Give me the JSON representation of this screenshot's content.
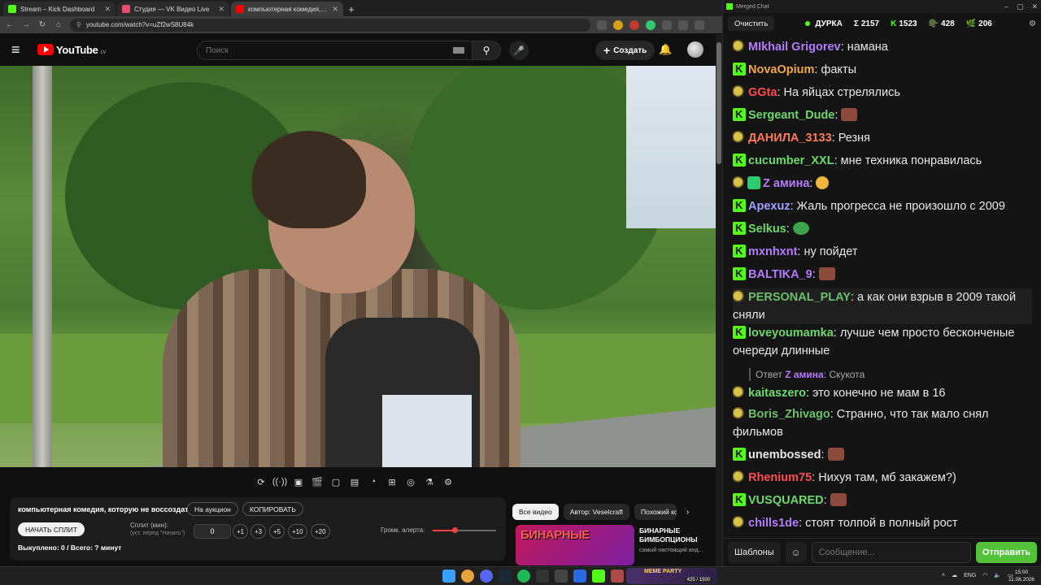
{
  "browser": {
    "tabs": [
      {
        "label": "Stream – Kick Dashboard",
        "icon_color": "#53fc18",
        "active": false
      },
      {
        "label": "Студия — VK Видео Live",
        "icon_color": "#e74c6c",
        "active": false
      },
      {
        "label": "компьютерная комедия, которую",
        "icon_color": "#ff0000",
        "active": true
      }
    ],
    "url": "youtube.com/watch?v=uZf2wS8U84k"
  },
  "youtube": {
    "logo_text": "YouTube",
    "country_code": "LV",
    "search_placeholder": "Поиск",
    "create_label": "Создать"
  },
  "panel": {
    "title": "компьютерная комедия, которую не воссоздать",
    "auction_btn": "На аукцион",
    "copy_btn": "КОПИРОВАТЬ",
    "start_split_btn": "НАЧАТЬ СПЛИТ",
    "split_label": "Сплит (мин):",
    "split_hint": "(уст. перед \"Начать\")",
    "minutes_value": "0",
    "increments": [
      "+1",
      "+3",
      "+5",
      "+10",
      "+20"
    ],
    "volume_label": "Громк. алерта:",
    "volume_level": 0.35,
    "stats": "Выкуплено: 0 / Всего: ? минут"
  },
  "recommendations": {
    "chips": [
      "Все видео",
      "Автор: Veselcraft",
      "Похожий ко"
    ],
    "thumb_text": "БИНАРНЫЕ",
    "title": "БИНАРНЫЕ БИМБОПЦИОНЫ",
    "subtitle": "самый настоящий анд..."
  },
  "chat": {
    "window_title": "Merged Chat",
    "clear_btn": "Очистить",
    "channel": "ДУРКА",
    "stats": [
      {
        "icon": "Σ",
        "value": "2157"
      },
      {
        "icon": "K",
        "value": "1523"
      },
      {
        "icon": "🪖",
        "value": "428"
      },
      {
        "icon": "🌿",
        "value": "206"
      }
    ],
    "messages": [
      {
        "platform": "tw",
        "user": "MIkhail Grigorev",
        "color": "#b47cff",
        "text": "намана"
      },
      {
        "platform": "kick",
        "user": "NovaOpium",
        "color": "#f0a94a",
        "text": "факты"
      },
      {
        "platform": "tw",
        "user": "GGta",
        "color": "#ff4d4d",
        "text": "На яйцах стрелялись"
      },
      {
        "platform": "kick",
        "user": "Sergeant_Dude",
        "color": "#6cd96c",
        "text": ""
      },
      {
        "platform": "tw",
        "user": "ДАНИЛА_3133",
        "color": "#ff7a5a",
        "text": "Резня"
      },
      {
        "platform": "kick",
        "user": "cucumber_XXL",
        "color": "#6cd96c",
        "text": "мне техника понравилась"
      },
      {
        "platform": "tw",
        "user": "Z амина",
        "color": "#b47cff",
        "text": ""
      },
      {
        "platform": "kick",
        "user": "Apexuz",
        "color": "#a0a0ff",
        "text": "Жаль прогресса не произошло с 2009"
      },
      {
        "platform": "kick",
        "user": "Selkus",
        "color": "#6cd96c",
        "text": ""
      },
      {
        "platform": "kick",
        "user": "mxnhxnt",
        "color": "#b47cff",
        "text": "ну пойдет"
      },
      {
        "platform": "kick",
        "user": "BALTIKA_9",
        "color": "#b47cff",
        "text": ""
      },
      {
        "platform": "tw",
        "user": "PERSONAL_PLAY",
        "color": "#6cbf6c",
        "text": "а как они взрыв в 2009 такой сняли"
      },
      {
        "platform": "kick",
        "user": "loveyoumamka",
        "color": "#6cd96c",
        "text": "лучше чем просто бесконченые очереди длинные"
      },
      {
        "platform": "tw",
        "user": "kaitaszero",
        "color": "#6cd96c",
        "text": "это конечно не мам в 16"
      },
      {
        "platform": "tw",
        "user": "Boris_Zhivago",
        "color": "#6cbf6c",
        "text": "Странно, что так мало снял фильмов"
      },
      {
        "platform": "kick",
        "user": "unembossed",
        "color": "#e8e8e8",
        "text": ""
      },
      {
        "platform": "tw",
        "user": "Rhenium75",
        "color": "#ff4d4d",
        "text": "Нихуя там, мб закажем?)"
      },
      {
        "platform": "kick",
        "user": "VUSQUARED",
        "color": "#6cd96c",
        "text": ""
      },
      {
        "platform": "tw",
        "user": "chills1de",
        "color": "#b47cff",
        "text": "стоят толпой в полный рост"
      }
    ],
    "reply": {
      "prefix": "Ответ",
      "user": "Z амина",
      "text": "Скукота"
    },
    "templates_btn": "Шаблоны",
    "input_placeholder": "Сообщение...",
    "send_btn": "Отправить"
  },
  "taskbar": {
    "widget_text": "MEME PARTY",
    "widget_counter": "425 / 1500",
    "lang": "ENG",
    "time": "15:00",
    "date": "11.08.2026"
  }
}
